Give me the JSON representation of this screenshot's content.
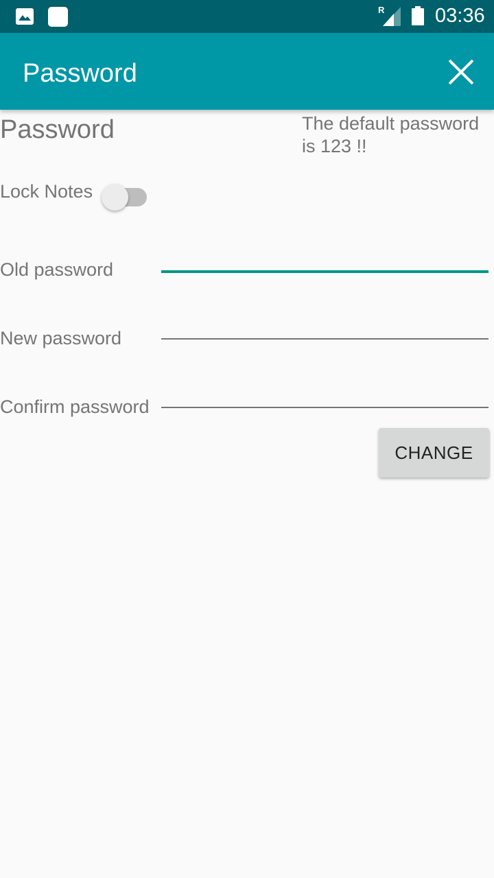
{
  "status_bar": {
    "left_icons": [
      "image-notification-icon",
      "app-notification-icon"
    ],
    "roaming_label": "R",
    "time": "03:36"
  },
  "app_bar": {
    "title": "Password",
    "close_icon": "close-icon"
  },
  "content": {
    "heading": "Password",
    "hint": "The default password is 123 !!",
    "lock_notes": {
      "label": "Lock Notes",
      "enabled": false
    },
    "fields": [
      {
        "label": "Old password",
        "value": "",
        "focused": true
      },
      {
        "label": "New password",
        "value": "",
        "focused": false
      },
      {
        "label": "Confirm password",
        "value": "",
        "focused": false
      }
    ],
    "change_button": "CHANGE"
  },
  "colors": {
    "status_bar": "#00606b",
    "app_bar": "#0097a7",
    "focus_accent": "#009688",
    "text_secondary": "#757575"
  }
}
